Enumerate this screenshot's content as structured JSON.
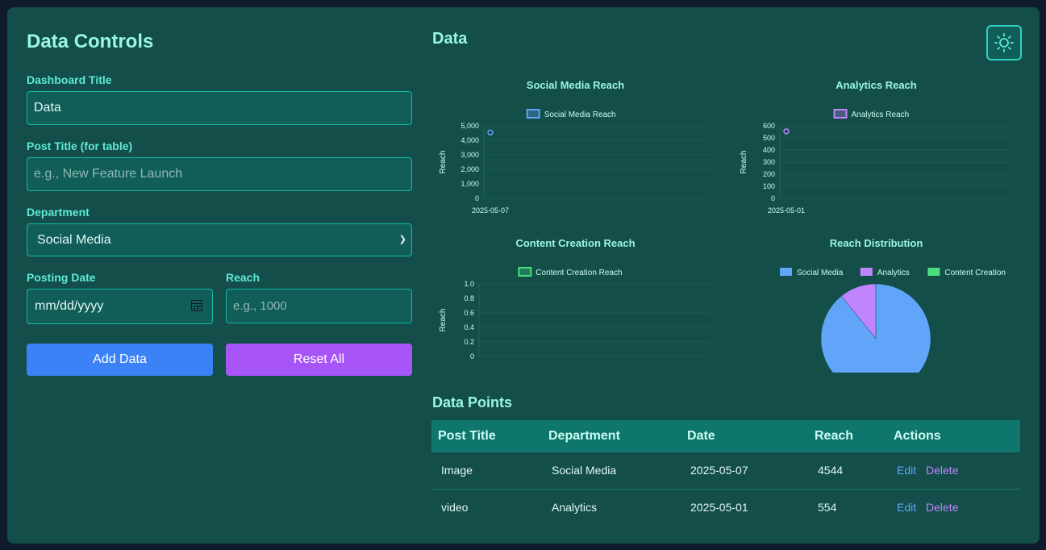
{
  "controls": {
    "title": "Data Controls",
    "dashboard_title_label": "Dashboard Title",
    "dashboard_title_value": "Data",
    "post_title_label": "Post Title (for table)",
    "post_title_placeholder": "e.g., New Feature Launch",
    "department_label": "Department",
    "department_value": "Social Media",
    "date_label": "Posting Date",
    "date_placeholder": "mm/dd/yyyy",
    "reach_label": "Reach",
    "reach_placeholder": "e.g., 1000",
    "add_label": "Add Data",
    "reset_label": "Reset All"
  },
  "dashboard": {
    "title": "Data",
    "table_title": "Data Points"
  },
  "colors": {
    "social": "#60a5fa",
    "analytics": "#c084fc",
    "content": "#4ade80"
  },
  "chart_data": [
    {
      "type": "line",
      "title": "Social Media Reach",
      "legend": [
        "Social Media Reach"
      ],
      "ylabel": "Reach",
      "x": [
        "2025-05-07"
      ],
      "series": [
        {
          "name": "Social Media Reach",
          "values": [
            4544
          ]
        }
      ],
      "yticks": [
        "5,000",
        "4,000",
        "3,000",
        "2,000",
        "1,000",
        "0"
      ],
      "ylim": [
        0,
        5000
      ]
    },
    {
      "type": "line",
      "title": "Analytics Reach",
      "legend": [
        "Analytics Reach"
      ],
      "ylabel": "Reach",
      "x": [
        "2025-05-01"
      ],
      "series": [
        {
          "name": "Analytics Reach",
          "values": [
            554
          ]
        }
      ],
      "yticks": [
        "600",
        "500",
        "400",
        "300",
        "200",
        "100",
        "0"
      ],
      "ylim": [
        0,
        600
      ]
    },
    {
      "type": "line",
      "title": "Content Creation Reach",
      "legend": [
        "Content Creation Reach"
      ],
      "ylabel": "Reach",
      "x": [],
      "series": [
        {
          "name": "Content Creation Reach",
          "values": []
        }
      ],
      "yticks": [
        "1.0",
        "0.8",
        "0.6",
        "0.4",
        "0.2",
        "0"
      ],
      "ylim": [
        0,
        1
      ]
    },
    {
      "type": "pie",
      "title": "Reach Distribution",
      "categories": [
        "Social Media",
        "Analytics",
        "Content Creation"
      ],
      "values": [
        4544,
        554,
        0
      ]
    }
  ],
  "table": {
    "headers": [
      "Post Title",
      "Department",
      "Date",
      "Reach",
      "Actions"
    ],
    "rows": [
      {
        "title": "Image",
        "dept": "Social Media",
        "date": "2025-05-07",
        "reach": "4544",
        "edit": "Edit",
        "delete": "Delete"
      },
      {
        "title": "video",
        "dept": "Analytics",
        "date": "2025-05-01",
        "reach": "554",
        "edit": "Edit",
        "delete": "Delete"
      }
    ]
  }
}
